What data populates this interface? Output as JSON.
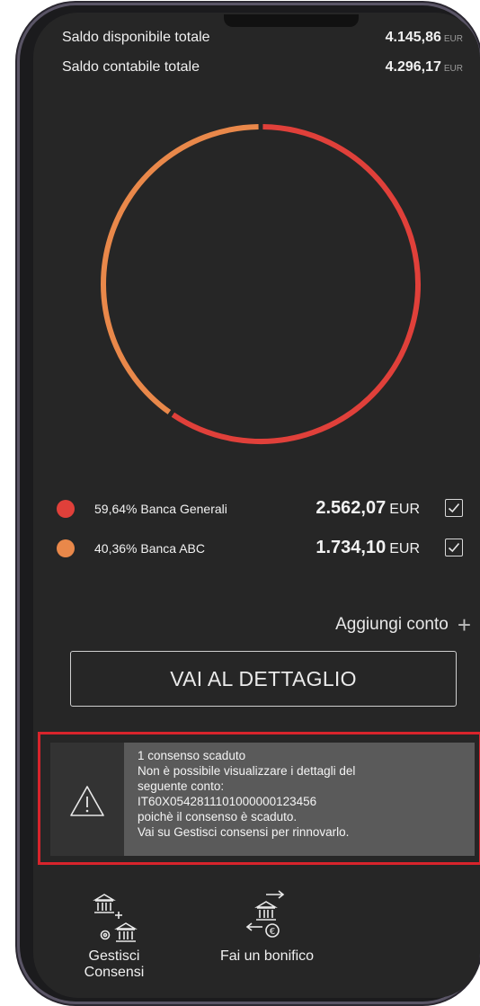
{
  "balances": [
    {
      "label": "Saldo disponibile totale",
      "value": "4.145,86",
      "currency": "EUR"
    },
    {
      "label": "Saldo contabile totale",
      "value": "4.296,17",
      "currency": "EUR"
    }
  ],
  "chart_data": {
    "type": "pie",
    "categories": [
      "Banca Generali",
      "Banca ABC"
    ],
    "values": [
      59.64,
      40.36
    ],
    "colors": [
      "#e0403a",
      "#e9884a"
    ]
  },
  "accounts": [
    {
      "percent": "59,64%",
      "bank": "Banca Generali",
      "amount": "2.562,07",
      "currency": "EUR",
      "color": "#e0403a",
      "checked": true
    },
    {
      "percent": "40,36%",
      "bank": "Banca ABC",
      "amount": "1.734,10",
      "currency": "EUR",
      "color": "#e9884a",
      "checked": true
    }
  ],
  "add_account": {
    "label": "Aggiungi conto",
    "icon": "plus-icon"
  },
  "detail_button": {
    "label": "VAI AL DETTAGLIO"
  },
  "alert": {
    "icon": "warning-icon",
    "lines": [
      "1 consenso scaduto",
      "Non è possibile visualizzare i dettagli del",
      "seguente conto:",
      "IT60X0542811101000000123456",
      "poichè il consenso è scaduto.",
      "Vai su Gestisci consensi per rinnovarlo."
    ]
  },
  "actions": [
    {
      "label_line1": "Gestisci",
      "label_line2": "Consensi",
      "icon": "manage-consents-icon"
    },
    {
      "label_line1": "Fai un bonifico",
      "icon": "bank-transfer-icon"
    }
  ],
  "colors": {
    "accent_red": "#d8242c",
    "background": "#262626"
  }
}
